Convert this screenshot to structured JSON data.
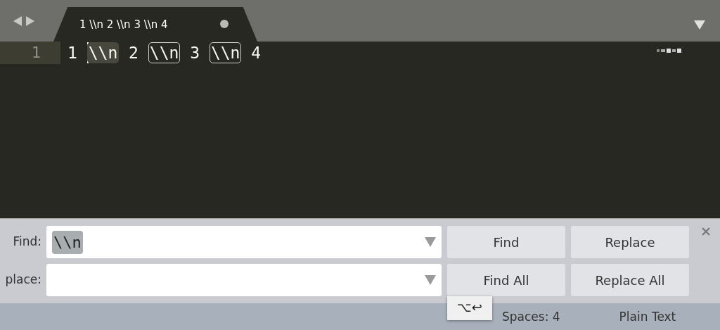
{
  "tab": {
    "title": "1 \\\\n 2 \\\\n 3 \\\\n 4",
    "modified": true,
    "selected": true
  },
  "editor": {
    "lines": [
      {
        "number": "1",
        "current": true,
        "segments": [
          {
            "kind": "text",
            "text": "1 "
          },
          {
            "kind": "match",
            "text": "\\\\n",
            "selected": true,
            "cursor": true
          },
          {
            "kind": "text",
            "text": " 2 "
          },
          {
            "kind": "match",
            "text": "\\\\n",
            "selected": false,
            "cursor": false
          },
          {
            "kind": "text",
            "text": " 3 "
          },
          {
            "kind": "match",
            "text": "\\\\n",
            "selected": false,
            "cursor": false
          },
          {
            "kind": "text",
            "text": " 4"
          }
        ]
      }
    ]
  },
  "find_panel": {
    "rows": [
      {
        "label": "Find:",
        "value": "\\\\n",
        "value_selected": true
      },
      {
        "label": "place:",
        "value": ""
      }
    ],
    "buttons": [
      [
        "Find",
        "Replace"
      ],
      [
        "Find All",
        "Replace All"
      ]
    ],
    "tooltip": "⌥↩"
  },
  "status_bar": {
    "indentation": "Spaces: 4",
    "syntax": "Plain Text"
  }
}
